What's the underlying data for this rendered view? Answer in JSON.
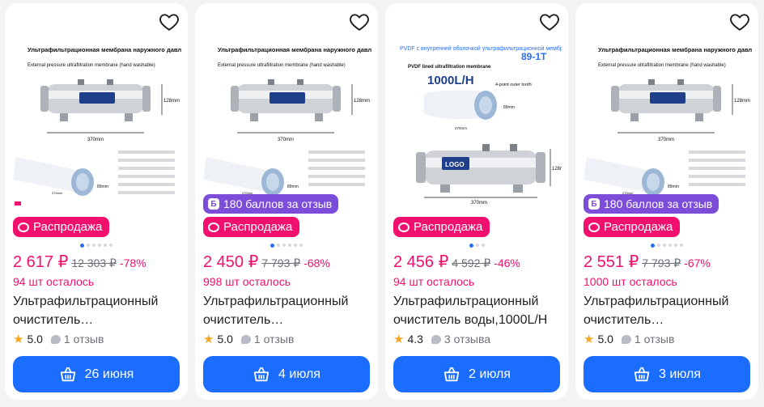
{
  "products": [
    {
      "image": {
        "title": "Ультрафильтрационная мембрана наружного давления (можно стирать вручную)",
        "subtitle": "External pressure ultrafiltration membrane (hand washable)",
        "dim_height": "128mm",
        "dim_length": "370mm",
        "dim_filter": "89mm",
        "dim_filter_len": "270mm"
      },
      "points_badge": "",
      "sale_label": "Распродажа",
      "price": "2 617 ₽",
      "old_price": "12 303 ₽",
      "discount": "-78%",
      "stock": "94 шт осталось",
      "title": "Ультрафильтрационный очиститель…",
      "rating": "5.0",
      "reviews": "1 отзыв",
      "delivery": "26 июня",
      "active_dot": 0
    },
    {
      "image": {
        "title": "Ультрафильтрационная мембрана наружного давления (можно стирать вручную)",
        "subtitle": "External pressure ultrafiltration membrane (hand washable)",
        "dim_height": "128mm",
        "dim_length": "370mm",
        "dim_filter": "89mm",
        "dim_filter_len": "270mm"
      },
      "points_badge": "180 баллов за отзыв",
      "sale_label": "Распродажа",
      "price": "2 450 ₽",
      "old_price": "7 793 ₽",
      "discount": "-68%",
      "stock": "998 шт осталось",
      "title": "Ультрафильтрационный очиститель…",
      "rating": "5.0",
      "reviews": "1 отзыв",
      "delivery": "4 июля",
      "active_dot": 0
    },
    {
      "image": {
        "title": "PVDF с внутренней оболочкой ультрафильтрационной мембраны",
        "model": "89-1T",
        "subtitle": "PVDF lined ultrafiltration membrane",
        "flow": "1000L/H",
        "teeth": "4-point outer tooth",
        "dim_height": "128mm",
        "dim_length": "370mm",
        "dim_filter": "89mm",
        "dim_filter_len": "270mm",
        "logo": "LOGO"
      },
      "points_badge": "",
      "sale_label": "Распродажа",
      "price": "2 456 ₽",
      "old_price": "4 592 ₽",
      "discount": "-46%",
      "stock": "94 шт осталось",
      "title": "Ультрафильтрационный очиститель воды,1000L/H",
      "rating": "4.3",
      "reviews": "3 отзыва",
      "delivery": "2 июля",
      "active_dot": 0
    },
    {
      "image": {
        "title": "Ультрафильтрационная мембрана наружного давления (можно стирать вручную)",
        "subtitle": "External pressure ultrafiltration membrane (hand washable)",
        "dim_height": "128mm",
        "dim_length": "370mm",
        "dim_filter": "89mm",
        "dim_filter_len": "270mm"
      },
      "points_badge": "180 баллов за отзыв",
      "sale_label": "Распродажа",
      "price": "2 551 ₽",
      "old_price": "7 793 ₽",
      "discount": "-67%",
      "stock": "1000 шт осталось",
      "title": "Ультрафильтрационный очиститель…",
      "rating": "5.0",
      "reviews": "1 отзыв",
      "delivery": "3 июля",
      "active_dot": 0
    }
  ],
  "colors": {
    "accent_blue": "#1a6dff",
    "sale_pink": "#f2106e",
    "points_purple": "#7b4dd8",
    "star": "#f5a623"
  },
  "icons": {
    "favorite": "heart-icon",
    "cart": "basket-icon",
    "rating": "star-icon",
    "reviews": "comment-icon"
  }
}
